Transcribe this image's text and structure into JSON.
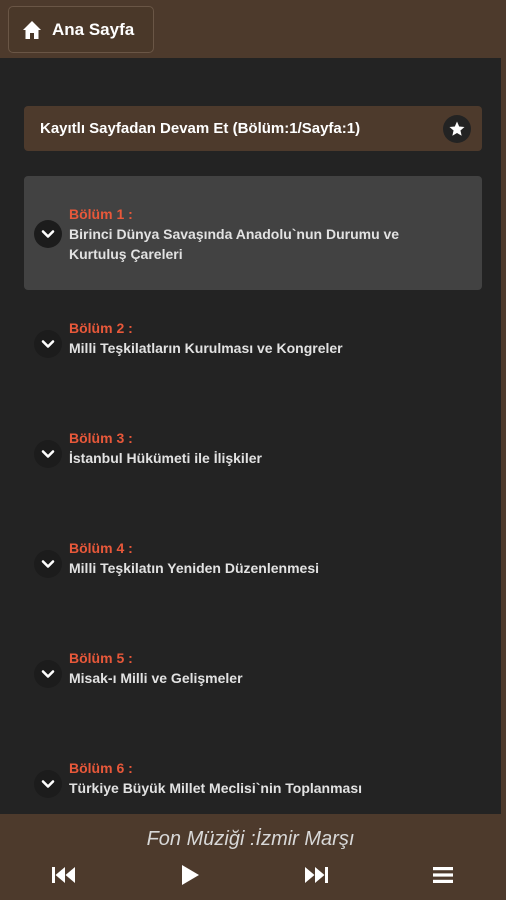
{
  "header": {
    "home_label": "Ana Sayfa",
    "home_icon": "home-icon"
  },
  "resume": {
    "label": "Kayıtlı Sayfadan Devam Et (Bölüm:1/Sayfa:1)",
    "icon": "star-icon"
  },
  "chapters": [
    {
      "number": "Bölüm 1 :",
      "title": "Birinci Dünya Savaşında Anadolu`nun Durumu ve Kurtuluş Çareleri"
    },
    {
      "number": "Bölüm 2 :",
      "title": "Milli Teşkilatların Kurulması ve Kongreler"
    },
    {
      "number": "Bölüm 3 :",
      "title": "İstanbul Hükümeti ile İlişkiler"
    },
    {
      "number": "Bölüm 4 :",
      "title": "Milli Teşkilatın Yeniden Düzenlenmesi"
    },
    {
      "number": "Bölüm 5 :",
      "title": "Misak-ı Milli ve Gelişmeler"
    },
    {
      "number": "Bölüm 6 :",
      "title": "Türkiye Büyük Millet Meclisi`nin Toplanması"
    }
  ],
  "player": {
    "music_title": "Fon Müziği :İzmir Marşı",
    "controls": [
      "previous-icon",
      "play-icon",
      "next-icon",
      "menu-icon"
    ]
  },
  "colors": {
    "brown": "#4d3a2c",
    "background": "#232323",
    "chapter_number": "#e8583a",
    "active_row": "#424242"
  }
}
